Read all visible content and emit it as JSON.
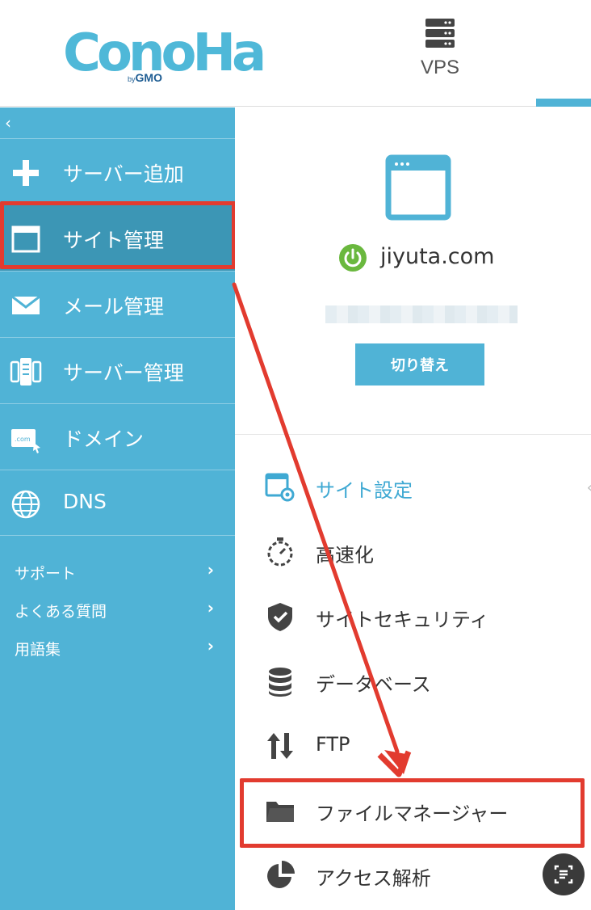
{
  "header": {
    "logo_text": "ConoHa",
    "logo_by": "by",
    "logo_company": "GMO",
    "vps_label": "VPS"
  },
  "sidebar": {
    "collapse_glyph": "‹",
    "items": [
      {
        "label": "サーバー追加",
        "icon": "plus-icon"
      },
      {
        "label": "サイト管理",
        "icon": "browser-window-icon",
        "active": true
      },
      {
        "label": "メール管理",
        "icon": "envelope-icon"
      },
      {
        "label": "サーバー管理",
        "icon": "server-devices-icon"
      },
      {
        "label": "ドメイン",
        "icon": "domain-icon"
      },
      {
        "label": "DNS",
        "icon": "globe-icon"
      }
    ],
    "support": [
      {
        "label": "サポート",
        "chevron": "›"
      },
      {
        "label": "よくある質問",
        "chevron": "›"
      },
      {
        "label": "用語集",
        "chevron": "›"
      }
    ]
  },
  "site": {
    "domain": "jiyuta.com",
    "switch_label": "切り替え",
    "status_color": "#6ab83e"
  },
  "menu": {
    "items": [
      {
        "label": "サイト設定",
        "icon": "site-settings-icon",
        "active": true
      },
      {
        "label": "高速化",
        "icon": "stopwatch-icon"
      },
      {
        "label": "サイトセキュリティ",
        "icon": "shield-check-icon"
      },
      {
        "label": "データベース",
        "icon": "database-icon"
      },
      {
        "label": "FTP",
        "icon": "transfer-arrows-icon"
      },
      {
        "label": "ファイルマネージャー",
        "icon": "folder-icon"
      },
      {
        "label": "アクセス解析",
        "icon": "pie-chart-icon"
      }
    ],
    "caret": "‹"
  },
  "colors": {
    "brand": "#50b3d6",
    "annotation": "#e23b2f"
  }
}
